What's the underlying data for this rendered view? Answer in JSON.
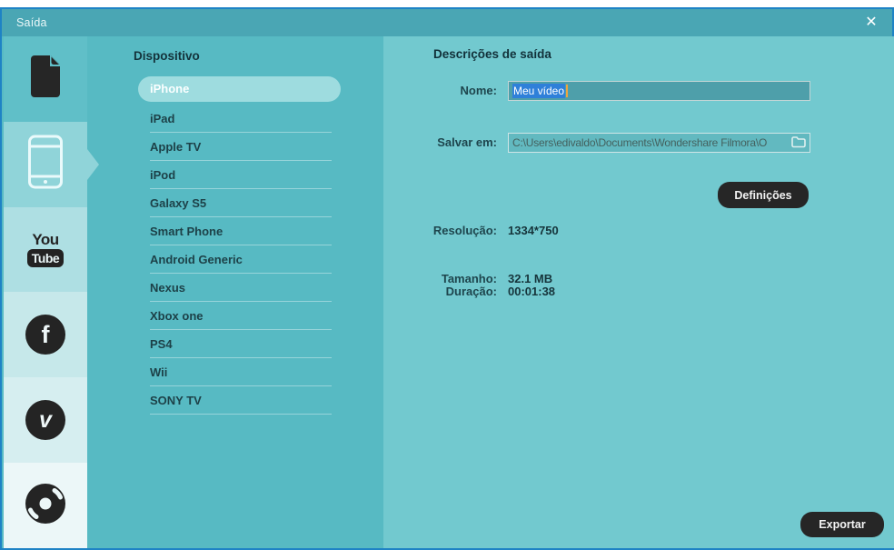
{
  "window": {
    "title": "Saída"
  },
  "icons": {
    "close": "✕",
    "facebook_glyph": "f",
    "vimeo_glyph": "v",
    "youtube_you": "You",
    "youtube_tube": "Tube"
  },
  "sidebar": {
    "tabs": [
      "local-file",
      "device",
      "youtube",
      "facebook",
      "vimeo",
      "dvd"
    ],
    "selected": "device"
  },
  "devices": {
    "header": "Dispositivo",
    "selected": "iPhone",
    "items": [
      "iPhone",
      "iPad",
      "Apple TV",
      "iPod",
      "Galaxy S5",
      "Smart Phone",
      "Android Generic",
      "Nexus",
      "Xbox one",
      "PS4",
      "Wii",
      "SONY TV"
    ]
  },
  "output": {
    "header": "Descrições de saída",
    "name_label": "Nome:",
    "name_value": "Meu vídeo",
    "save_label": "Salvar em:",
    "save_value": "C:\\Users\\edivaldo\\Documents\\Wondershare Filmora\\O",
    "resolution_label": "Resolução:",
    "resolution_value": "1334*750",
    "settings_button": "Definições",
    "size_label": "Tamanho:",
    "size_value": "32.1 MB",
    "duration_label": "Duração:",
    "duration_value": "00:01:38",
    "export_button": "Exportar"
  },
  "colors": {
    "window_border": "#1e83c5",
    "titlebar": "#4aa6b4",
    "middle_panel": "#57bac3",
    "right_panel": "#72c9cf",
    "selected_pill": "#9edcdf",
    "selection_blue": "#2f80d9",
    "caret_orange": "#eea43f",
    "dark_button": "#262626"
  }
}
